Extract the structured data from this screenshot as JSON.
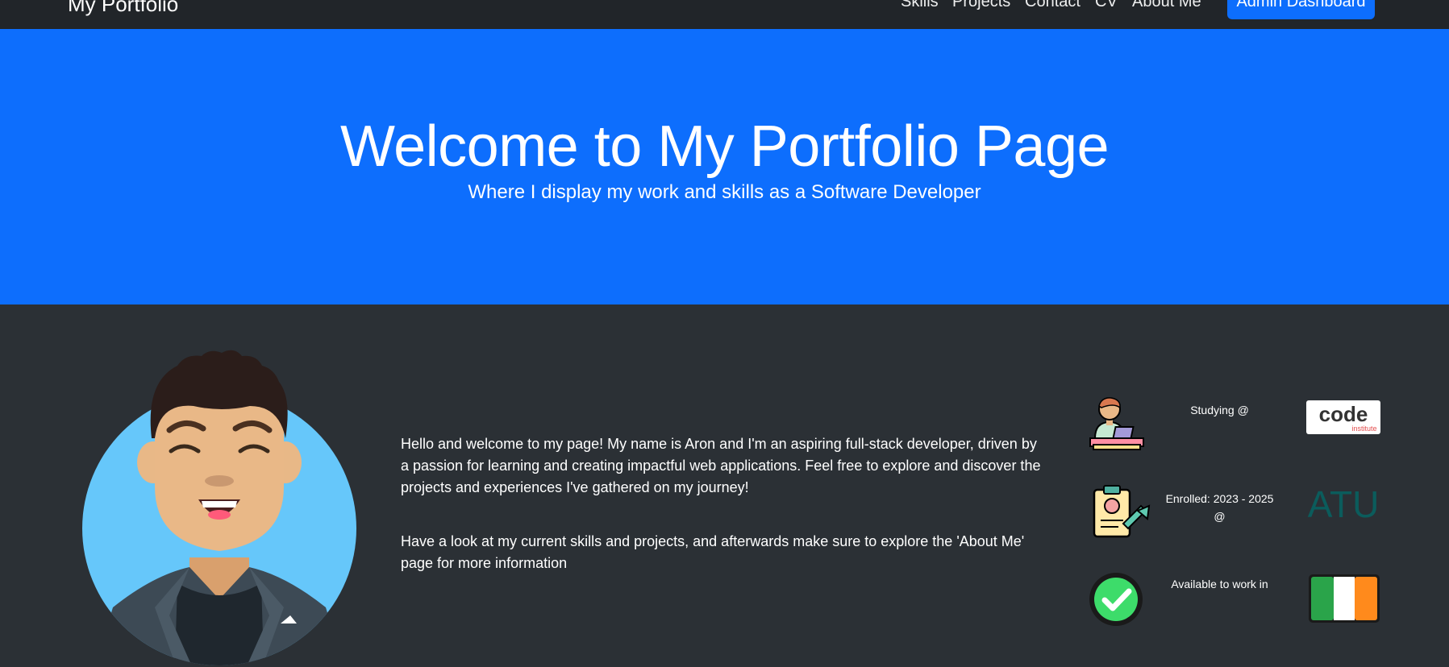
{
  "navbar": {
    "brand": "My Portfolio",
    "links": [
      "Skills",
      "Projects",
      "Contact",
      "CV",
      "About Me"
    ],
    "admin_button": "Admin Dashboard"
  },
  "hero": {
    "title": "Welcome to My Portfolio Page",
    "subtitle": "Where I display my work and skills as a Software Developer"
  },
  "intro": {
    "paragraph_1": "Hello and welcome to my page! My name is Aron and I'm an aspiring full-stack developer, driven by a passion for learning and creating impactful web applications. Feel free to explore and discover the projects and experiences I've gathered on my journey!",
    "paragraph_2": "Have a look at my current skills and projects, and afterwards make sure to explore the 'About Me' page for more information"
  },
  "info": [
    {
      "label": "Studying @",
      "icon": "student-laptop-icon",
      "logo": "code-institute-logo",
      "logo_text": "code",
      "logo_subtext": "institute"
    },
    {
      "label": "Enrolled: 2023 - 2025 @",
      "icon": "clipboard-profile-icon",
      "logo": "atu-logo",
      "logo_text": "ATU"
    },
    {
      "label": "Available to work in",
      "icon": "checkmark-icon",
      "logo": "ireland-flag-icon"
    }
  ],
  "colors": {
    "navbar_bg": "#212529",
    "hero_bg": "#0d6efd",
    "main_bg": "#2b3035",
    "accent": "#0d6efd"
  }
}
